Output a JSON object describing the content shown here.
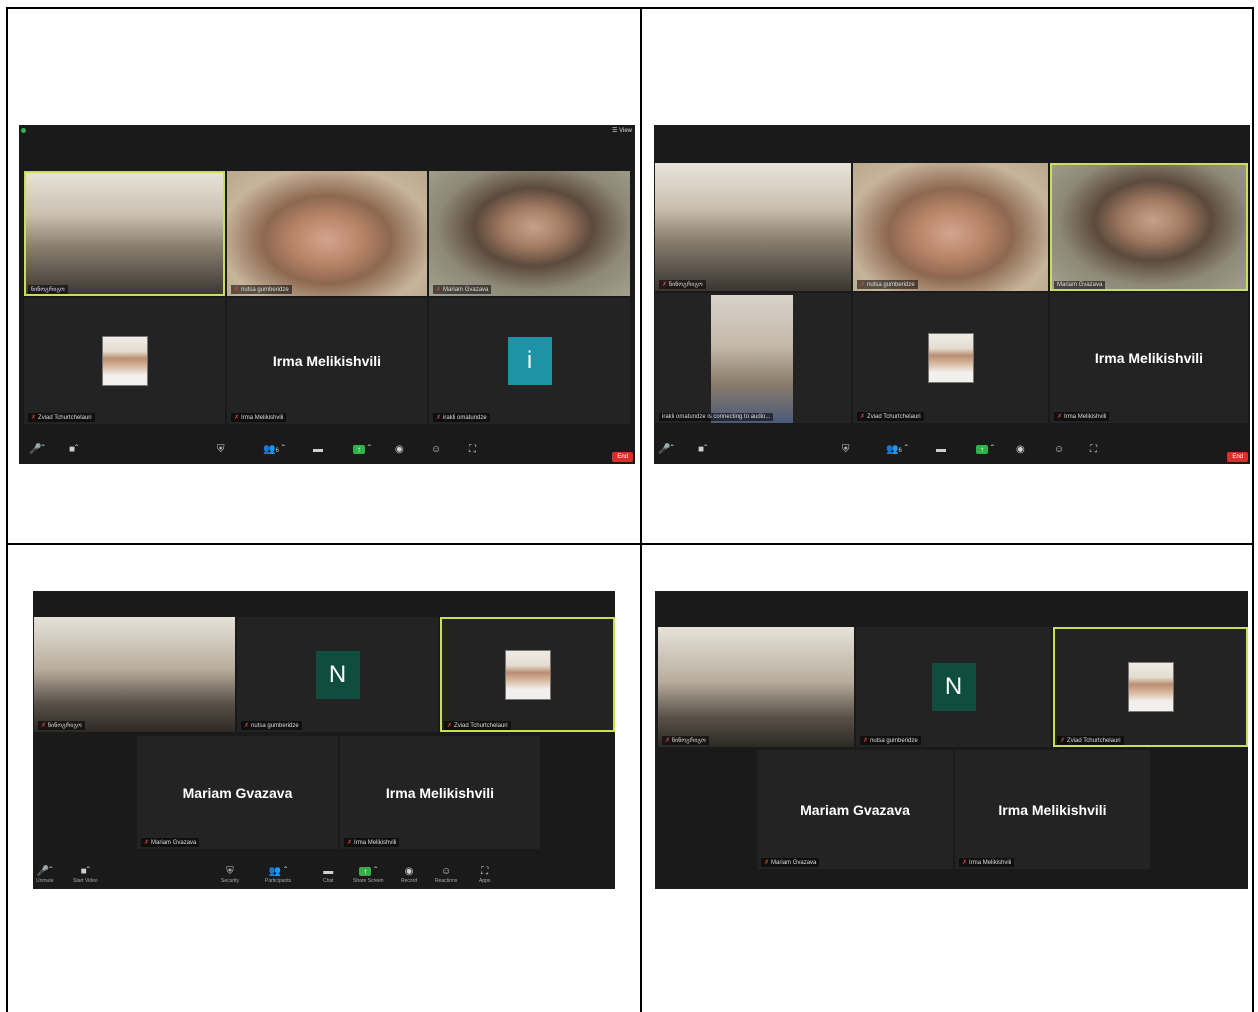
{
  "panels": [
    {
      "tiles": [
        {
          "name": "ნინოგრიგო",
          "kind": "video"
        },
        {
          "name": "nutsa gumberidze",
          "kind": "video"
        },
        {
          "name": "Mariam Gvazava",
          "kind": "video"
        },
        {
          "name": "Zviad Tchurtchelauri",
          "kind": "photo"
        },
        {
          "name": "Irma Melikishvili",
          "big": "Irma Melikishvili",
          "kind": "text"
        },
        {
          "name": "irakli omatundze",
          "letter": "i",
          "kind": "letter"
        }
      ],
      "view_label": "View",
      "end_label": "End"
    },
    {
      "tiles": [
        {
          "name": "ნინოგრიგო",
          "kind": "video"
        },
        {
          "name": "nutsa gumberidze",
          "kind": "video"
        },
        {
          "name": "Mariam Gvazava",
          "kind": "video"
        },
        {
          "name": "irakli omatundze is connecting to audio...",
          "kind": "video"
        },
        {
          "name": "Zviad Tchurtchelauri",
          "kind": "photo"
        },
        {
          "name": "Irma Melikishvili",
          "big": "Irma Melikishvili",
          "kind": "text"
        }
      ],
      "end_label": "End"
    },
    {
      "tiles": [
        {
          "name": "ნინოგრიგო",
          "kind": "video"
        },
        {
          "name": "nutsa gumberidze",
          "letter": "N",
          "kind": "letter"
        },
        {
          "name": "Zviad Tchurtchelauri",
          "kind": "photo"
        },
        {
          "name": "Mariam Gvazava",
          "big": "Mariam Gvazava",
          "kind": "text"
        },
        {
          "name": "Irma Melikishvili",
          "big": "Irma Melikishvili",
          "kind": "text"
        }
      ],
      "toolbar_labels": [
        "Unmute",
        "Start Video",
        "Security",
        "Participants",
        "Chat",
        "Share Screen",
        "Record",
        "Reactions",
        "Apps"
      ]
    },
    {
      "tiles": [
        {
          "name": "ნინოგრიგო",
          "kind": "video"
        },
        {
          "name": "nutsa gumberidze",
          "letter": "N",
          "kind": "letter"
        },
        {
          "name": "Zviad Tchurtchelauri",
          "kind": "photo"
        },
        {
          "name": "Mariam Gvazava",
          "big": "Mariam Gvazava",
          "kind": "text"
        },
        {
          "name": "Irma Melikishvili",
          "big": "Irma Melikishvili",
          "kind": "text"
        }
      ]
    }
  ],
  "participants_count": "6",
  "colors": {
    "accent_green": "#2db34a",
    "active_border": "#c9de5a",
    "end_red": "#d9302a",
    "teal_avatar": "#1e93a8",
    "dark_green_avatar": "#0f4d3f"
  },
  "icons": [
    "microphone-muted-icon",
    "video-camera-icon",
    "shield-icon",
    "participants-icon",
    "chat-icon",
    "share-screen-icon",
    "record-icon",
    "reactions-icon",
    "fullscreen-icon"
  ]
}
